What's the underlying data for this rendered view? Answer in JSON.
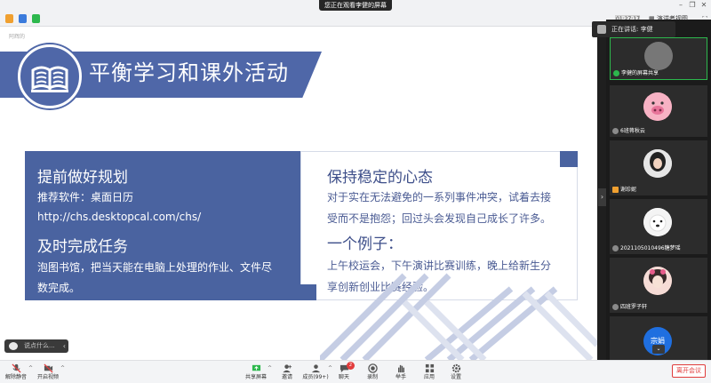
{
  "topbar": {
    "share_banner": "您正在观看李健的屏幕",
    "time": "01:27:17",
    "view_label": "演讲者视图"
  },
  "slide": {
    "corner_tag": "阿辉的",
    "title": "平衡学习和课外活动",
    "left": {
      "heading1": "提前做好规划",
      "line1": "推荐软件：桌面日历",
      "line2": "http://chs.desktopcal.com/chs/",
      "heading2": "及时完成任务",
      "line3": "泡图书馆，把当天能在电脑上处理的作业、文件尽",
      "line4": "数完成。"
    },
    "right": {
      "heading1": "保持稳定的心态",
      "line1": "对于实在无法避免的一系列事件冲突，试着去接",
      "line2": "受而不是抱怨；回过头会发现自己成长了许多。",
      "heading2": "一个例子：",
      "line3": "上午校运会，下午演讲比赛训练，晚上给新生分",
      "line4": "享创新创业比赛经验。"
    }
  },
  "caption": {
    "text": "说点什么..."
  },
  "sidebar": {
    "speaking": "正在讲话: 李健",
    "tiles": [
      {
        "label": "李健的屏幕共享"
      },
      {
        "label": "6班蒋秋云"
      },
      {
        "label": "谢珍妮"
      },
      {
        "label": "2021105010496糖梦瑶"
      },
      {
        "label": "四班罗子轩"
      },
      {
        "label": "宗娟"
      }
    ]
  },
  "toolbar": {
    "mute": "解除静音",
    "video": "开启视频",
    "share": "共享屏幕",
    "invite": "邀请",
    "members": "成员(99+)",
    "chat": "聊天",
    "chat_badge": "2",
    "record": "录制",
    "raise": "举手",
    "apps": "应用",
    "settings": "设置",
    "leave": "离开会议"
  },
  "colors": {
    "slide_blue": "#4f67a8",
    "active_green": "#2db84d",
    "leave_red": "#e03b3b"
  }
}
